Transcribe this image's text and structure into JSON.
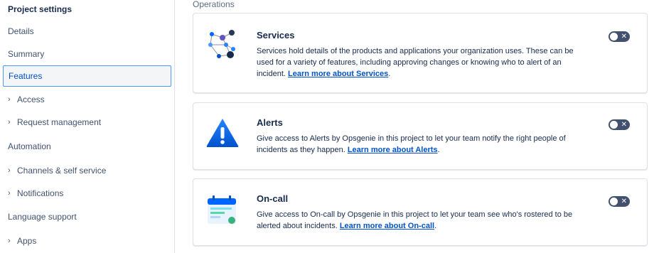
{
  "sidebar": {
    "title": "Project settings",
    "items": [
      {
        "label": "Details",
        "chevron": false,
        "selected": false
      },
      {
        "label": "Summary",
        "chevron": false,
        "selected": false
      },
      {
        "label": "Features",
        "chevron": false,
        "selected": true
      },
      {
        "label": "Access",
        "chevron": true,
        "selected": false
      },
      {
        "label": "Request management",
        "chevron": true,
        "selected": false
      },
      {
        "label": "Automation",
        "chevron": false,
        "selected": false
      },
      {
        "label": "Channels & self service",
        "chevron": true,
        "selected": false
      },
      {
        "label": "Notifications",
        "chevron": true,
        "selected": false
      },
      {
        "label": "Language support",
        "chevron": false,
        "selected": false
      },
      {
        "label": "Apps",
        "chevron": true,
        "selected": false
      }
    ]
  },
  "main": {
    "section_heading": "Operations",
    "features": [
      {
        "title": "Services",
        "description": "Services hold details of the products and applications your organization uses. These can be used for a variety of features, including approving changes or knowing who to alert of an incident. ",
        "link": "Learn more about Services",
        "after_link": ".",
        "icon": "services-network-icon",
        "enabled": false
      },
      {
        "title": "Alerts",
        "description": "Give access to Alerts by Opsgenie in this project to let your team notify the right people of incidents as they happen. ",
        "link": "Learn more about Alerts",
        "after_link": ".",
        "icon": "alert-triangle-icon",
        "enabled": false
      },
      {
        "title": "On-call",
        "description": "Give access to On-call by Opsgenie in this project to let your team see who's rostered to be alerted about incidents. ",
        "link": "Learn more about On-call",
        "after_link": ".",
        "icon": "calendar-icon",
        "enabled": false
      }
    ]
  },
  "colors": {
    "link": "#0052cc",
    "toggle_off": "#42526e",
    "selected_border": "#4c9aff",
    "alert_blue": "#2684ff",
    "calendar_blue": "#0065ff",
    "calendar_green": "#57d9a3"
  }
}
